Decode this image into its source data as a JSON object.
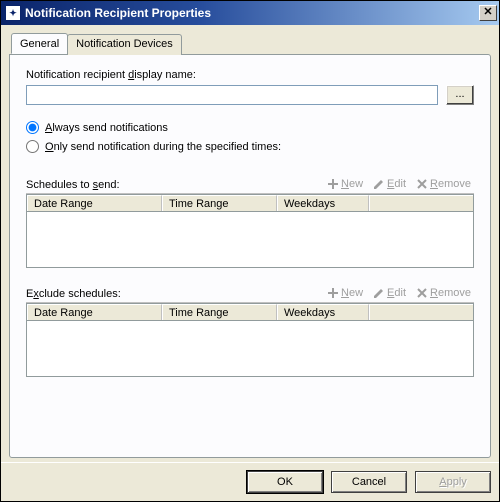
{
  "window": {
    "title": "Notification Recipient Properties",
    "close": "✕"
  },
  "tabs": {
    "general": "General",
    "devices": "Notification Devices"
  },
  "general": {
    "display_name_label_pre": "Notification recipient ",
    "display_name_underline": "d",
    "display_name_label_post": "isplay name:",
    "display_name_value": "",
    "browse": "...",
    "radio_always_pre": "",
    "radio_always_underline": "A",
    "radio_always_post": "lways send notifications",
    "radio_only_pre": "",
    "radio_only_underline": "O",
    "radio_only_post": "nly send notification during the specified times:",
    "schedules_label_pre": "Schedules to ",
    "schedules_underline": "s",
    "schedules_label_post": "end:",
    "exclude_label_pre": "E",
    "exclude_underline": "x",
    "exclude_label_post": "clude schedules:",
    "toolbar": {
      "new_underline": "N",
      "new_post": "ew",
      "edit_underline": "E",
      "edit_post": "dit",
      "remove_underline": "R",
      "remove_post": "emove"
    },
    "columns": {
      "date_range": "Date Range",
      "time_range": "Time Range",
      "weekdays": "Weekdays"
    }
  },
  "buttons": {
    "ok": "OK",
    "cancel": "Cancel",
    "apply_underline": "A",
    "apply_post": "pply"
  }
}
